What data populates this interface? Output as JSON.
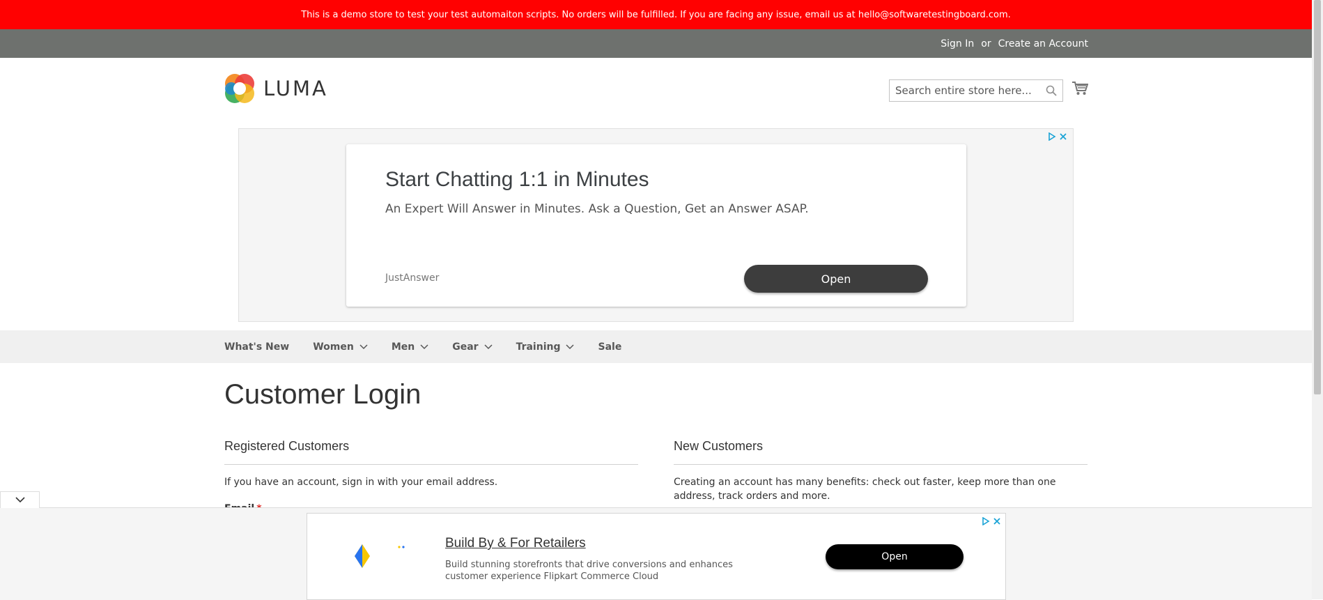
{
  "demo_notice": "This is a demo store to test your test automaiton scripts. No orders will be fulfilled. If you are facing any issue, email us at hello@softwaretestingboard.com.",
  "header": {
    "sign_in": "Sign In",
    "or": "or",
    "create_account": "Create an Account",
    "logo_text": "LUMA",
    "search_placeholder": "Search entire store here...",
    "cart_icon": "cart-icon"
  },
  "ad_top": {
    "title": "Start Chatting 1:1 in Minutes",
    "subtitle": "An Expert Will Answer in Minutes. Ask a Question, Get an Answer ASAP.",
    "advertiser": "JustAnswer",
    "button": "Open"
  },
  "nav": {
    "items": [
      {
        "label": "What's New",
        "has_dropdown": false
      },
      {
        "label": "Women",
        "has_dropdown": true
      },
      {
        "label": "Men",
        "has_dropdown": true
      },
      {
        "label": "Gear",
        "has_dropdown": true
      },
      {
        "label": "Training",
        "has_dropdown": true
      },
      {
        "label": "Sale",
        "has_dropdown": false
      }
    ]
  },
  "main": {
    "page_title": "Customer Login",
    "registered": {
      "title": "Registered Customers",
      "text": "If you have an account, sign in with your email address.",
      "email_label": "Email",
      "required_mark": "*"
    },
    "new_customers": {
      "title": "New Customers",
      "text": "Creating an account has many benefits: check out faster, keep more than one address, track orders and more."
    }
  },
  "ad_bottom": {
    "title": "Build By & For Retailers",
    "description": "Build stunning storefronts that drive conversions and enhances customer experience Flipkart Commerce Cloud",
    "button": "Open"
  },
  "colors": {
    "demo_bar": "#ff0101",
    "links_bar": "#6e716e",
    "nav_bg": "#f0f0f0"
  }
}
